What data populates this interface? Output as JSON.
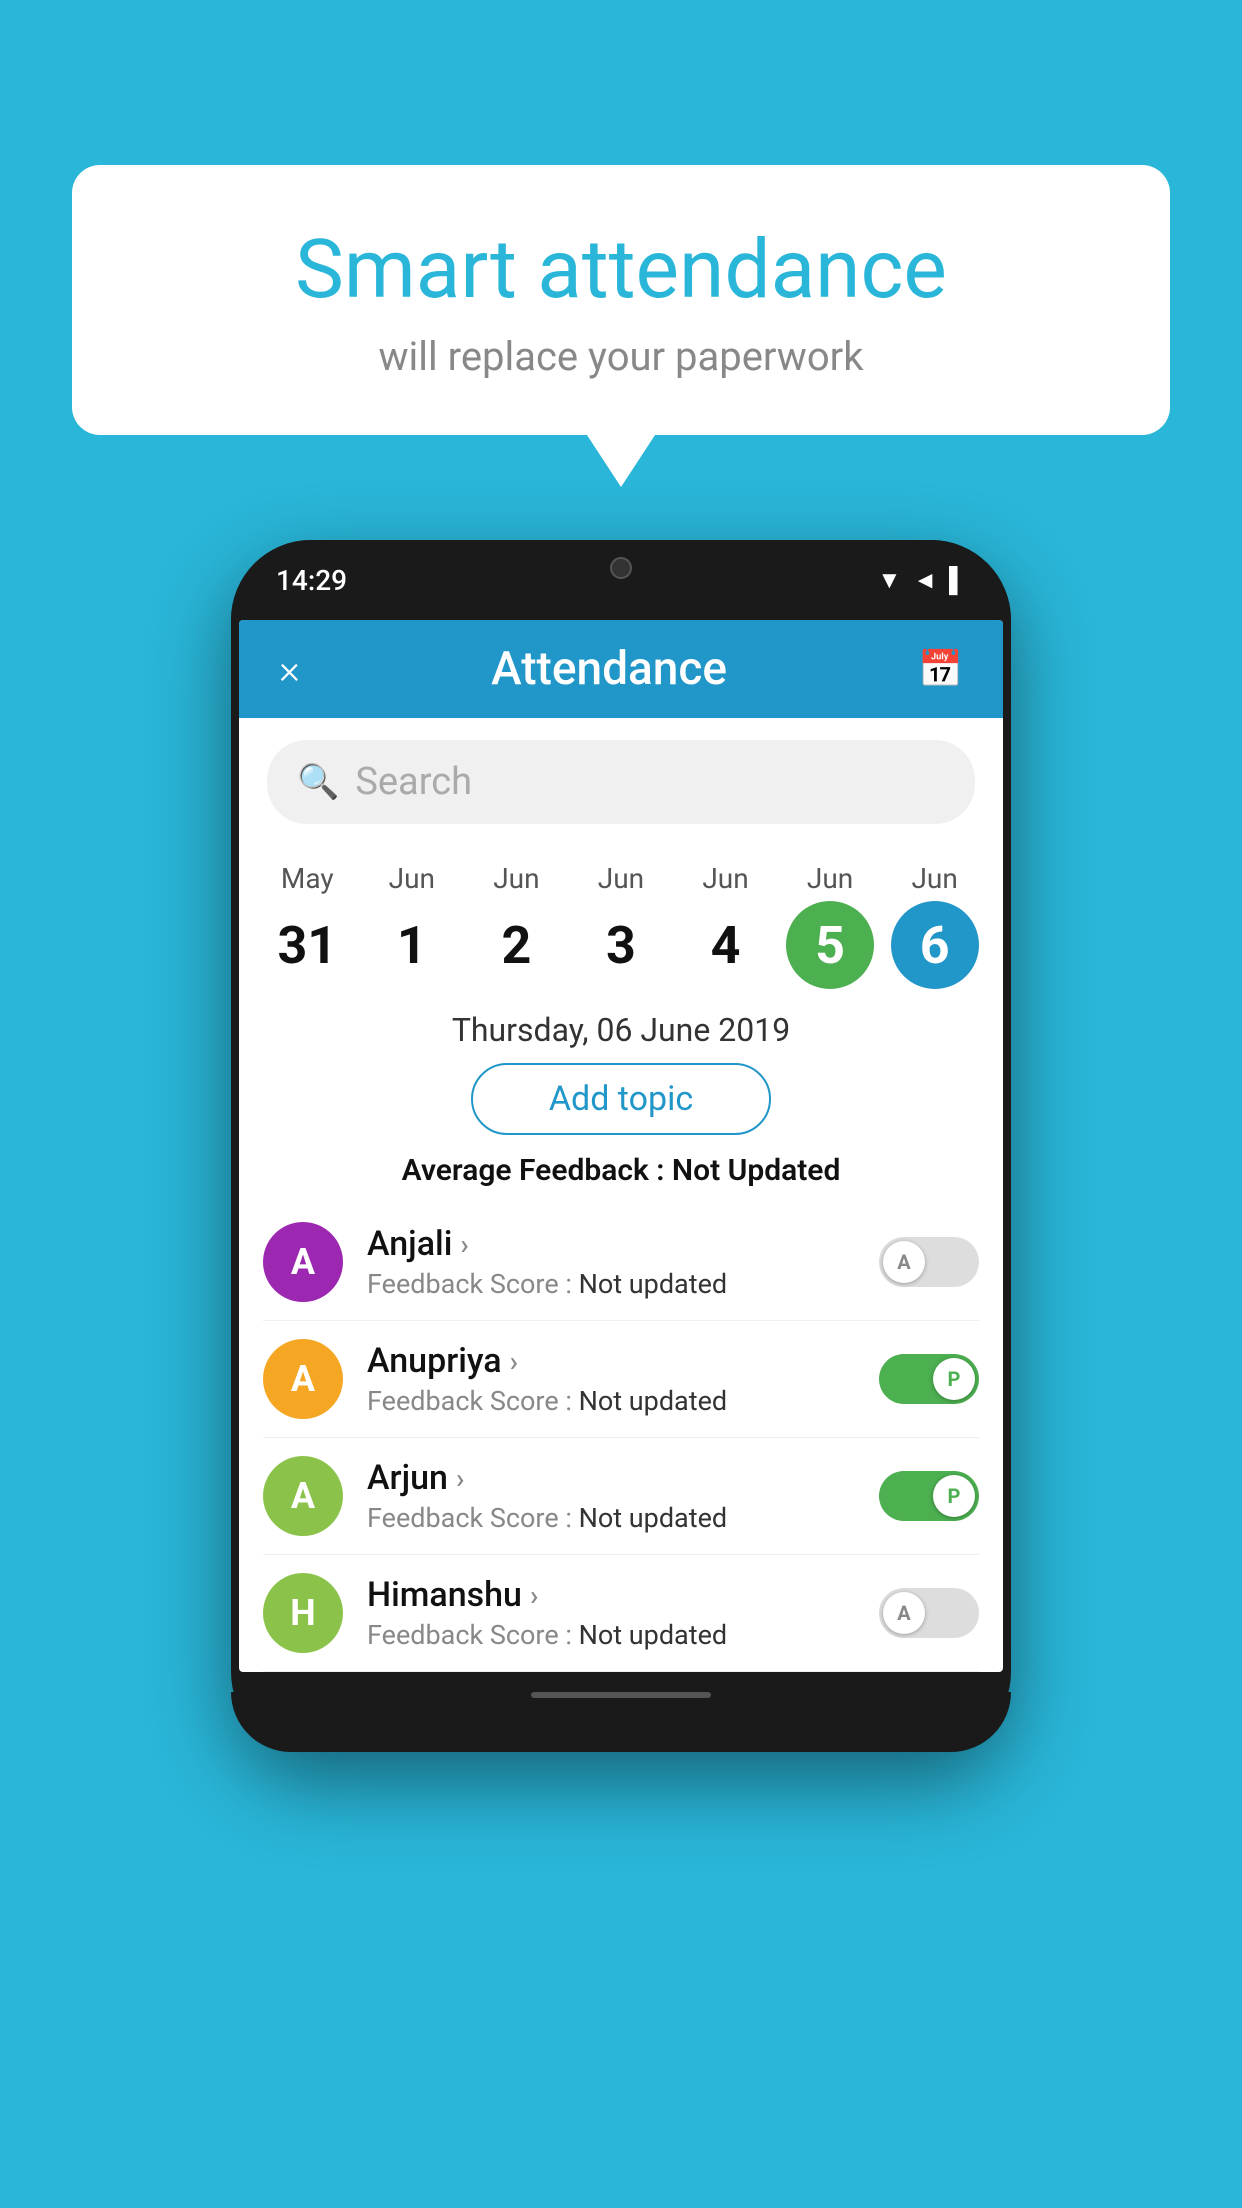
{
  "background_color": "#29b6d8",
  "bubble": {
    "title": "Smart attendance",
    "subtitle": "will replace your paperwork"
  },
  "phone": {
    "status_bar": {
      "time": "14:29"
    },
    "header": {
      "title": "Attendance",
      "close_icon": "×",
      "calendar_icon": "📅"
    },
    "search": {
      "placeholder": "Search"
    },
    "calendar": {
      "days": [
        {
          "month": "May",
          "date": "31",
          "style": "normal"
        },
        {
          "month": "Jun",
          "date": "1",
          "style": "normal"
        },
        {
          "month": "Jun",
          "date": "2",
          "style": "normal"
        },
        {
          "month": "Jun",
          "date": "3",
          "style": "normal"
        },
        {
          "month": "Jun",
          "date": "4",
          "style": "normal"
        },
        {
          "month": "Jun",
          "date": "5",
          "style": "today"
        },
        {
          "month": "Jun",
          "date": "6",
          "style": "selected"
        }
      ]
    },
    "selected_date": "Thursday, 06 June 2019",
    "add_topic_label": "Add topic",
    "avg_feedback_label": "Average Feedback :",
    "avg_feedback_value": "Not Updated",
    "students": [
      {
        "name": "Anjali",
        "avatar_letter": "A",
        "avatar_color": "#9c27b0",
        "feedback_label": "Feedback Score :",
        "feedback_value": "Not updated",
        "toggle_state": "off",
        "toggle_label": "A"
      },
      {
        "name": "Anupriya",
        "avatar_letter": "A",
        "avatar_color": "#f5a623",
        "feedback_label": "Feedback Score :",
        "feedback_value": "Not updated",
        "toggle_state": "on",
        "toggle_label": "P"
      },
      {
        "name": "Arjun",
        "avatar_letter": "A",
        "avatar_color": "#8bc34a",
        "feedback_label": "Feedback Score :",
        "feedback_value": "Not updated",
        "toggle_state": "on",
        "toggle_label": "P"
      },
      {
        "name": "Himanshu",
        "avatar_letter": "H",
        "avatar_color": "#8bc34a",
        "feedback_label": "Feedback Score :",
        "feedback_value": "Not updated",
        "toggle_state": "off",
        "toggle_label": "A"
      }
    ]
  }
}
